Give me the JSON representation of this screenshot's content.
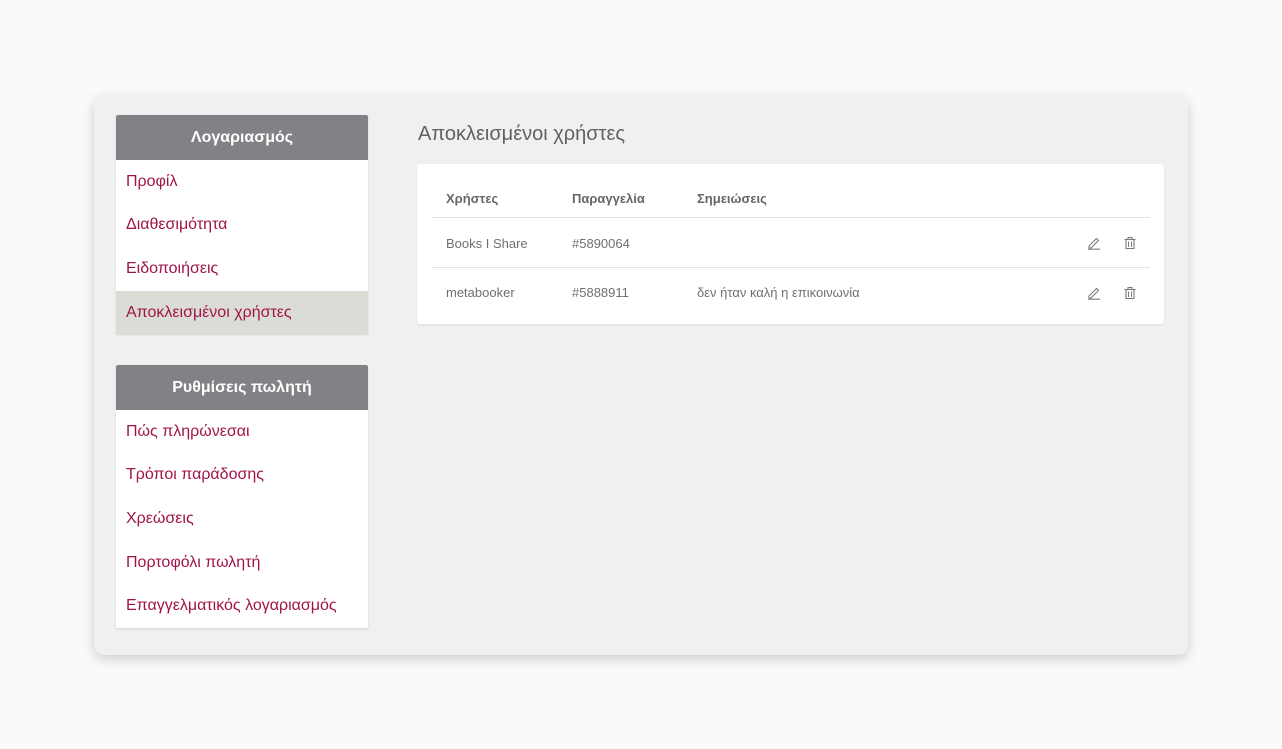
{
  "sidebar": {
    "account": {
      "title": "Λογαριασμός",
      "items": [
        {
          "label": "Προφίλ"
        },
        {
          "label": "Διαθεσιμότητα"
        },
        {
          "label": "Ειδοποιήσεις"
        },
        {
          "label": "Αποκλεισμένοι χρήστες",
          "active": true
        }
      ]
    },
    "seller": {
      "title": "Ρυθμίσεις πωλητή",
      "items": [
        {
          "label": "Πώς πληρώνεσαι"
        },
        {
          "label": "Τρόποι παράδοσης"
        },
        {
          "label": "Χρεώσεις"
        },
        {
          "label": "Πορτοφόλι πωλητή"
        },
        {
          "label": "Επαγγελματικός λογαριασμός"
        }
      ]
    }
  },
  "main": {
    "title": "Αποκλεισμένοι χρήστες",
    "table": {
      "headers": {
        "users": "Χρήστες",
        "order": "Παραγγελία",
        "notes": "Σημειώσεις"
      },
      "rows": [
        {
          "user": "Books I Share",
          "order": "#5890064",
          "notes": ""
        },
        {
          "user": "metabooker",
          "order": "#5888911",
          "notes": "δεν ήταν καλή η επικοινωνία"
        }
      ],
      "row_actions": [
        "edit-icon",
        "trash-icon"
      ]
    }
  },
  "colors": {
    "accent": "#a0144a",
    "header_bg": "#808285",
    "active_item_bg": "#dcdcd7"
  }
}
